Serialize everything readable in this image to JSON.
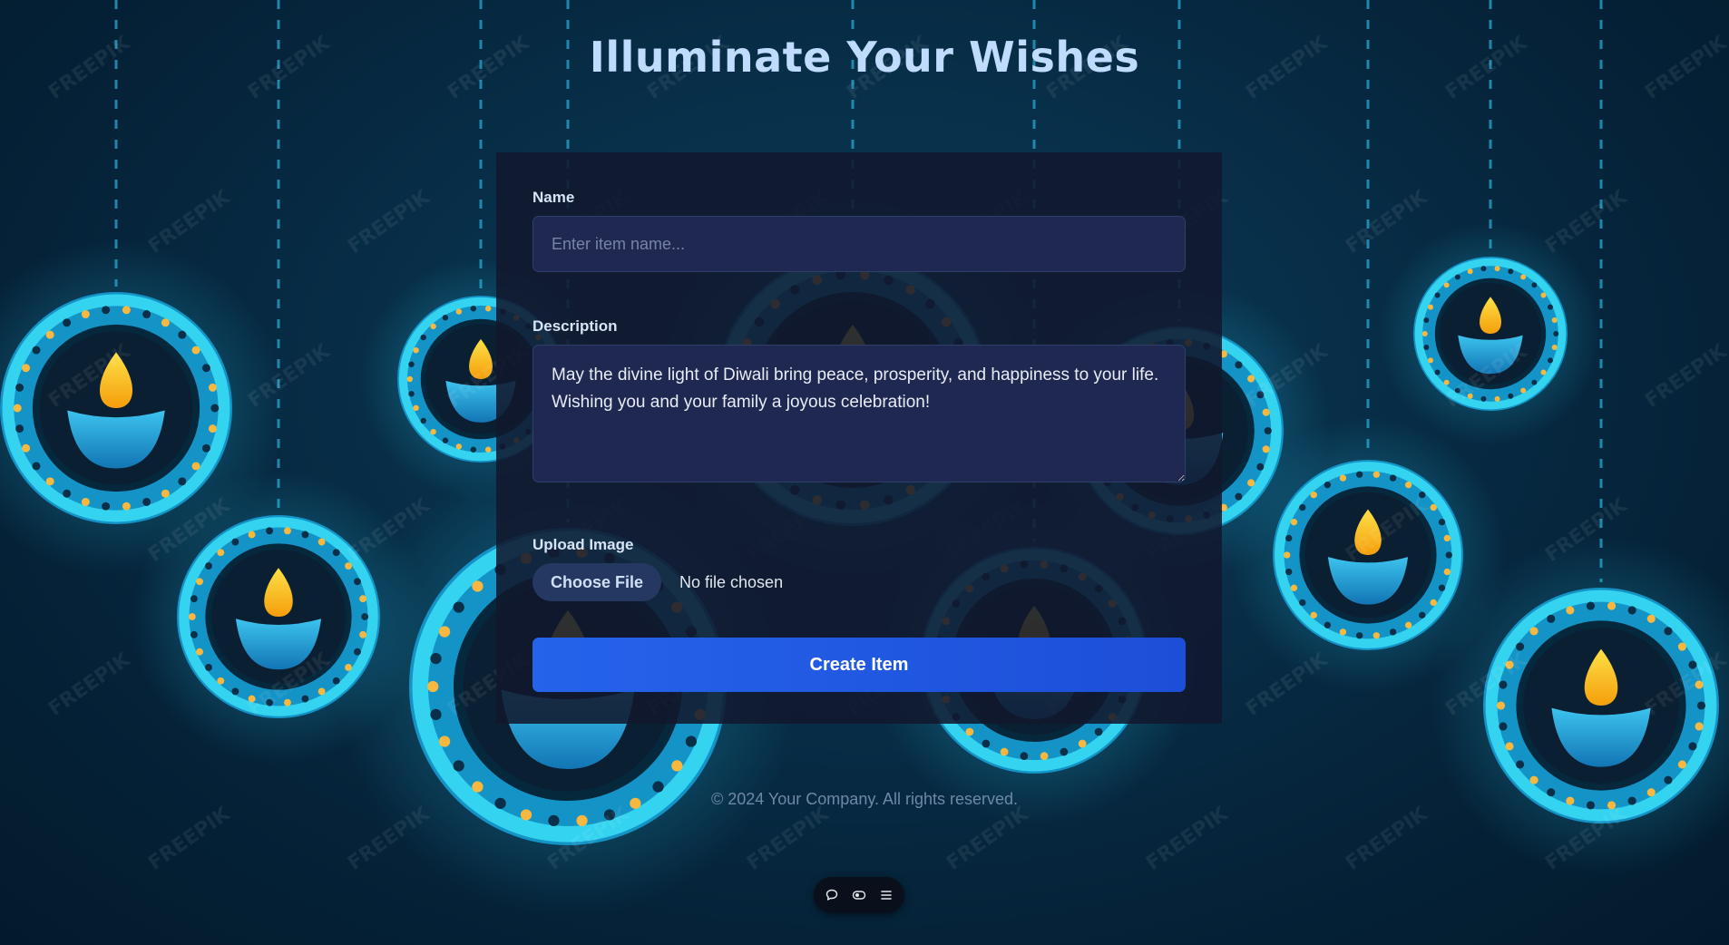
{
  "page": {
    "title": "Illuminate Your Wishes"
  },
  "form": {
    "name_label": "Name",
    "name_placeholder": "Enter item name...",
    "name_value": "",
    "description_label": "Description",
    "description_value": "May the divine light of Diwali bring peace, prosperity, and happiness to your life. Wishing you and your family a joyous celebration!",
    "upload_label": "Upload Image",
    "choose_file_label": "Choose File",
    "file_status": "No file chosen",
    "submit_label": "Create Item"
  },
  "footer": {
    "copyright": "© 2024 Your Company. All rights reserved."
  },
  "toolbar": {
    "icons": [
      "comment-icon",
      "eye-toggle-icon",
      "menu-icon"
    ]
  },
  "background": {
    "watermark": "FREEPIK",
    "subject": "hanging diya lamps"
  },
  "colors": {
    "title": "#bfdbfe",
    "accent": "#2563eb",
    "card": "#11182e",
    "input": "#1e2850",
    "lamp_ring": "#27c4e6",
    "flame": "#facc15"
  }
}
